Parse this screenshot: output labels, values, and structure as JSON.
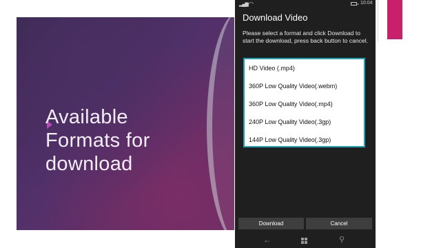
{
  "slide": {
    "title": "Available\nFormats for\ndownload"
  },
  "status_bar": {
    "time": "10:04"
  },
  "dialog": {
    "title": "Download Video",
    "message": "Please select a format and click Download to start the download, press back button to cancel.",
    "formats": [
      "HD Video (.mp4)",
      "360P Low Quality Video(.webm)",
      "360P Low Quality Video(.mp4)",
      "240P Low Quality Video(.3gp)",
      "144P Low Quality Video(.3gp)"
    ],
    "download_label": "Download",
    "cancel_label": "Cancel"
  },
  "nav": {
    "back_icon": "back-arrow-icon",
    "home_icon": "windows-icon",
    "search_icon": "search-icon"
  },
  "colors": {
    "list_border": "#1fa3b7",
    "accent": "#c8206a",
    "phone_bg": "#1f1f1f"
  }
}
